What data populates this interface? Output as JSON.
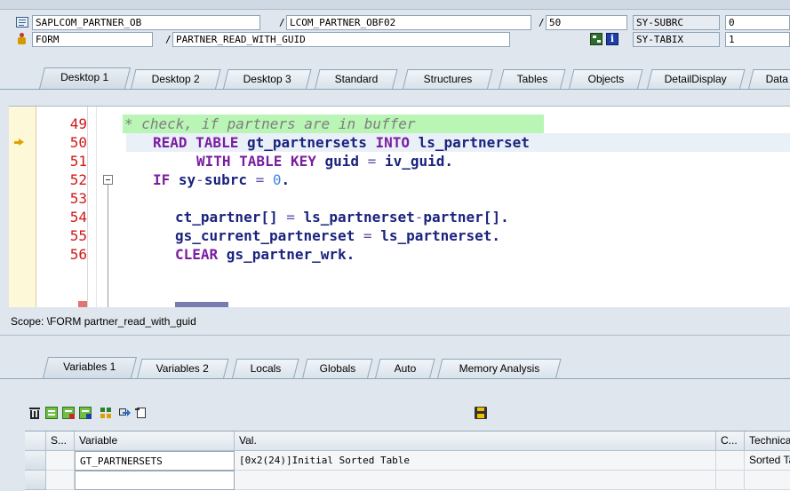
{
  "header": {
    "program": "SAPLCOM_PARTNER_OB",
    "include": "LCOM_PARTNER_OBF02",
    "line_number": "50",
    "sy_subrc_label": "SY-SUBRC",
    "sy_subrc_value": "0",
    "event_type": "FORM",
    "event_name": "PARTNER_READ_WITH_GUID",
    "sy_tabix_label": "SY-TABIX",
    "sy_tabix_value": "1",
    "slash": "/"
  },
  "desktop_tabs": [
    {
      "label": "Desktop 1",
      "active": true
    },
    {
      "label": "Desktop 2"
    },
    {
      "label": "Desktop 3"
    },
    {
      "label": "Standard"
    },
    {
      "label": "Structures"
    },
    {
      "label": "Tables"
    },
    {
      "label": "Objects"
    },
    {
      "label": "DetailDisplay"
    },
    {
      "label": "Data"
    }
  ],
  "code_lines": [
    {
      "no": "49",
      "text": "* check, if partners are in buffer"
    },
    {
      "no": "50",
      "text": "READ TABLE gt_partnersets INTO ls_partnerset"
    },
    {
      "no": "51",
      "text": "WITH TABLE KEY guid = iv_guid."
    },
    {
      "no": "52",
      "text": "IF sy-subrc = 0."
    },
    {
      "no": "53",
      "text": ""
    },
    {
      "no": "54",
      "text": "ct_partner[] = ls_partnerset-partner[]."
    },
    {
      "no": "55",
      "text": "gs_current_partnerset = ls_partnerset."
    },
    {
      "no": "56",
      "text": "CLEAR gs_partner_wrk."
    }
  ],
  "scope": "Scope: \\FORM partner_read_with_guid",
  "variable_tabs": [
    {
      "label": "Variables 1",
      "active": true
    },
    {
      "label": "Variables 2"
    },
    {
      "label": "Locals"
    },
    {
      "label": "Globals"
    },
    {
      "label": "Auto"
    },
    {
      "label": "Memory Analysis"
    }
  ],
  "grid": {
    "columns": [
      "S...",
      "Variable",
      "Val.",
      "C...",
      "Technical T"
    ],
    "rows": [
      {
        "variable": "GT_PARTNERSETS",
        "value": "[0x2(24)]Initial Sorted Table",
        "c": "",
        "technical": "Sorted Tab"
      },
      {
        "variable": "",
        "value": "",
        "c": "",
        "technical": ""
      }
    ]
  },
  "toolbar_icons": [
    "delete-icon",
    "variable-icon",
    "variable-add-icon",
    "save-variables-icon",
    "tree-icon",
    "navigate-icon",
    "change-icon",
    "save-icon"
  ],
  "colors": {
    "line_number": "#d11818",
    "keyword": "#7a1ea1",
    "comment_bg": "#b9f5b5",
    "current_line_bg": "#eaf0f8",
    "gutter_bg": "#fdf8d8",
    "arrow": "#e4a000"
  }
}
